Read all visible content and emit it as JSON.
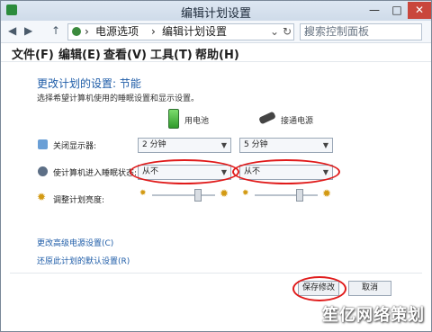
{
  "window": {
    "title": "编辑计划设置",
    "buttons": {
      "minimize": "—",
      "maximize": "□",
      "close": "✕"
    }
  },
  "address_bar": {
    "back": "◀",
    "forward": "▶",
    "up": "↑",
    "crumbs": [
      "电源选项",
      "编辑计划设置"
    ],
    "crumb_separator": "›",
    "dropdown": "⌄",
    "refresh": "↻",
    "search_placeholder": "搜索控制面板",
    "search_icon": "⌕"
  },
  "menu": [
    "文件(F)",
    "编辑(E)",
    "查看(V)",
    "工具(T)",
    "帮助(H)"
  ],
  "heading": "更改计划的设置: 节能",
  "subheading": "选择希望计算机使用的睡眠设置和显示设置。",
  "columns": {
    "battery": "用电池",
    "plugged": "接通电源"
  },
  "rows": {
    "display_off": {
      "label": "关闭显示器:",
      "battery": "2 分钟",
      "plugged": "5 分钟"
    },
    "sleep": {
      "label": "使计算机进入睡眠状态:",
      "battery": "从不",
      "plugged": "从不"
    },
    "brightness": {
      "label": "调整计划亮度:",
      "battery_level": 0.75,
      "plugged_level": 0.75
    }
  },
  "links": {
    "advanced": "更改高级电源设置(C)",
    "restore": "还原此计划的默认设置(R)"
  },
  "buttons": {
    "save": "保存修改",
    "cancel": "取消"
  },
  "watermark": "笙亿网络策划",
  "colors": {
    "annotation": "#e01b1b",
    "link": "#1f5da8",
    "title_bar": "#cfdbe9"
  },
  "icons": {
    "app": "power-options-icon",
    "battery": "battery-icon",
    "plug": "power-plug-icon",
    "display": "monitor-icon",
    "sleep": "moon-icon",
    "brightness": "sun-icon"
  }
}
